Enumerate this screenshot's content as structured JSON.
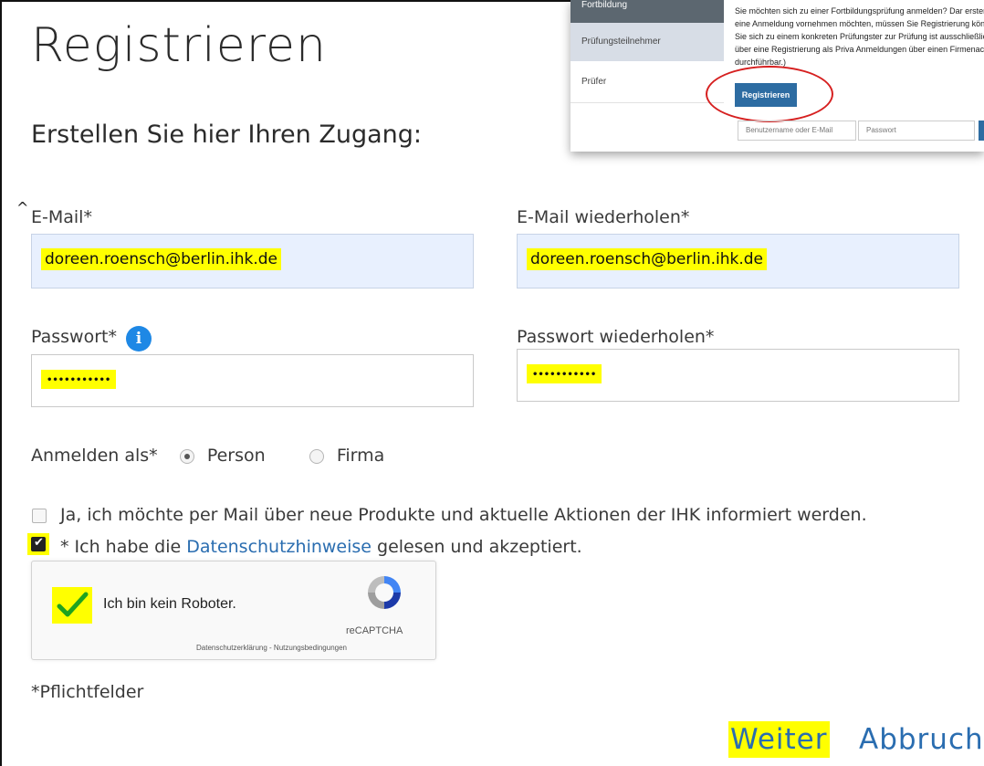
{
  "page": {
    "title": "Registrieren",
    "subtitle": "Erstellen Sie hier Ihren Zugang:",
    "caret": "^"
  },
  "form": {
    "email_label": "E-Mail*",
    "email_value": "doreen.roensch@berlin.ihk.de",
    "email_repeat_label": "E-Mail wiederholen*",
    "email_repeat_value": "doreen.roensch@berlin.ihk.de",
    "password_label": "Passwort*",
    "password_info_icon": "info-icon",
    "password_value_masked": "•••••••••••",
    "password_repeat_label": "Passwort wiederholen*",
    "password_repeat_value_masked": "•••••••••••",
    "register_as_label": "Anmelden als*",
    "options": [
      {
        "label": "Person",
        "selected": true
      },
      {
        "label": "Firma",
        "selected": false
      }
    ],
    "newsletter_text": "Ja, ich möchte per Mail über neue Produkte und aktuelle Aktionen der IHK informiert werden.",
    "newsletter_checked": false,
    "privacy_prefix": "* Ich habe die ",
    "privacy_link": "Datenschutzhinweise",
    "privacy_suffix": " gelesen und akzeptiert.",
    "privacy_checked": true
  },
  "captcha": {
    "text": "Ich bin kein Roboter.",
    "brand": "reCAPTCHA",
    "terms": "Datenschutzerklärung - Nutzungsbedingungen",
    "checked": true
  },
  "footer": {
    "required_note": "*Pflichtfelder",
    "next_label": "Weiter",
    "cancel_label": "Abbruch"
  },
  "inset": {
    "nav": [
      "Fortbildung",
      "Prüfungsteilnehmer",
      "Prüfer"
    ],
    "paragraph": "Sie möchten sich zu einer Fortbildungsprüfung anmelden? Dar ersten Mal eine Anmeldung vornehmen möchten, müssen Sie Registrierung können Sie sich zu einem konkreten Prüfungster zur Prüfung ist ausschließlich über eine Registrierung als Priva Anmeldungen über einen Firmenaccount durchführbar.)",
    "register_button": "Registrieren",
    "username_placeholder": "Benutzername oder E-Mail",
    "password_placeholder": "Passwort"
  },
  "colors": {
    "highlight": "#ffff00",
    "link": "#2a6db0",
    "info": "#1e88e5",
    "ring": "#d62020"
  }
}
